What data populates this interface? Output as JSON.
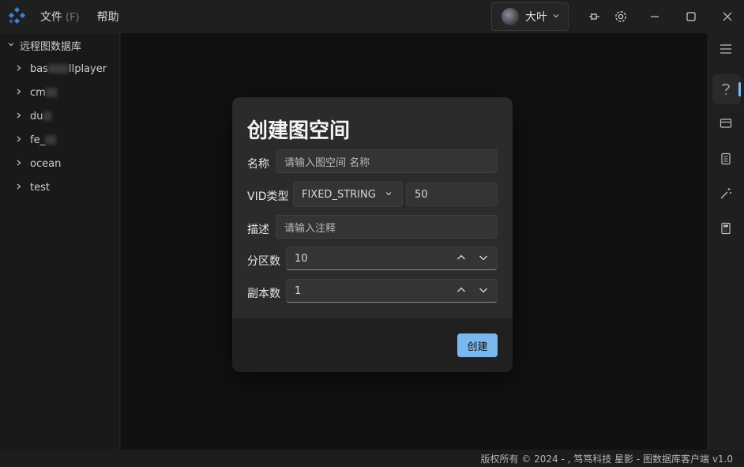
{
  "menu": {
    "file_label": "文件",
    "file_hint": "(F)",
    "help_label": "帮助"
  },
  "user": {
    "name": "大叶"
  },
  "sidebar": {
    "root_label": "远程图数据库",
    "items": [
      {
        "prefix": "bas",
        "suffix": "llplayer"
      },
      {
        "prefix": "cm",
        "suffix": ""
      },
      {
        "prefix": "du",
        "suffix": ""
      },
      {
        "prefix": "fe_",
        "suffix": ""
      },
      {
        "prefix": "ocean",
        "suffix": ""
      },
      {
        "prefix": "test",
        "suffix": ""
      }
    ]
  },
  "dialog": {
    "title": "创建图空间",
    "name_label": "名称",
    "name_placeholder": "请输入图空间 名称",
    "vid_label": "VID类型",
    "vid_type": "FIXED_STRING",
    "vid_length": "50",
    "desc_label": "描述",
    "desc_placeholder": "请输入注释",
    "partition_label": "分区数",
    "partition_value": "10",
    "replica_label": "副本数",
    "replica_value": "1",
    "create_label": "创建"
  },
  "status": {
    "text": "版权所有 © 2024 - ,  笃笃科技  星影 - 图数据库客户端  v1.0"
  },
  "colors": {
    "accent": "#79b8ef",
    "logo": "#3c7fd6"
  }
}
